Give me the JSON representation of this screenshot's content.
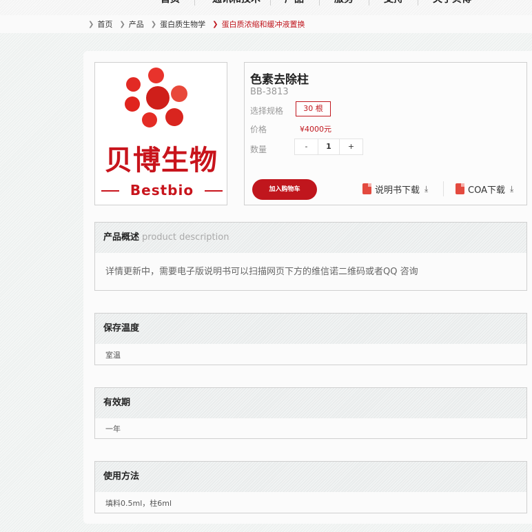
{
  "nav": {
    "items": [
      "首页",
      "通讯和技术",
      "产品",
      "服务",
      "支持",
      "关于贝博"
    ]
  },
  "breadcrumb": [
    "首页",
    "产品",
    "蛋白质生物学",
    "蛋白质浓缩和缓冲液置换"
  ],
  "logo": {
    "cn": "贝博生物",
    "en": "Bestbio"
  },
  "product": {
    "title": "色素去除柱",
    "code": "BB-3813",
    "spec_label": "选择规格",
    "spec_value": "30 根",
    "price_label": "价格",
    "price": "¥4000元",
    "qty_label": "数量",
    "qty_minus": "-",
    "qty_value": "1",
    "qty_plus": "+",
    "cart_button": "加入购物车",
    "manual_download": "说明书下载",
    "coa_download": "COA下载"
  },
  "sections": {
    "overview": {
      "title": "产品概述",
      "subtitle": "product description",
      "body": "详情更新中，需要电子版说明书可以扫描网页下方的维信诺二维码或者QQ 咨询"
    },
    "storage": {
      "title": "保存温度",
      "body": "室温"
    },
    "validity": {
      "title": "有效期",
      "body": "一年"
    },
    "usage": {
      "title": "使用方法",
      "body": "填料0.5ml，柱6ml"
    }
  },
  "colors": {
    "accent": "#c0161d",
    "logo_red": "#c8141c",
    "pdf_icon": "#e34a3f"
  }
}
